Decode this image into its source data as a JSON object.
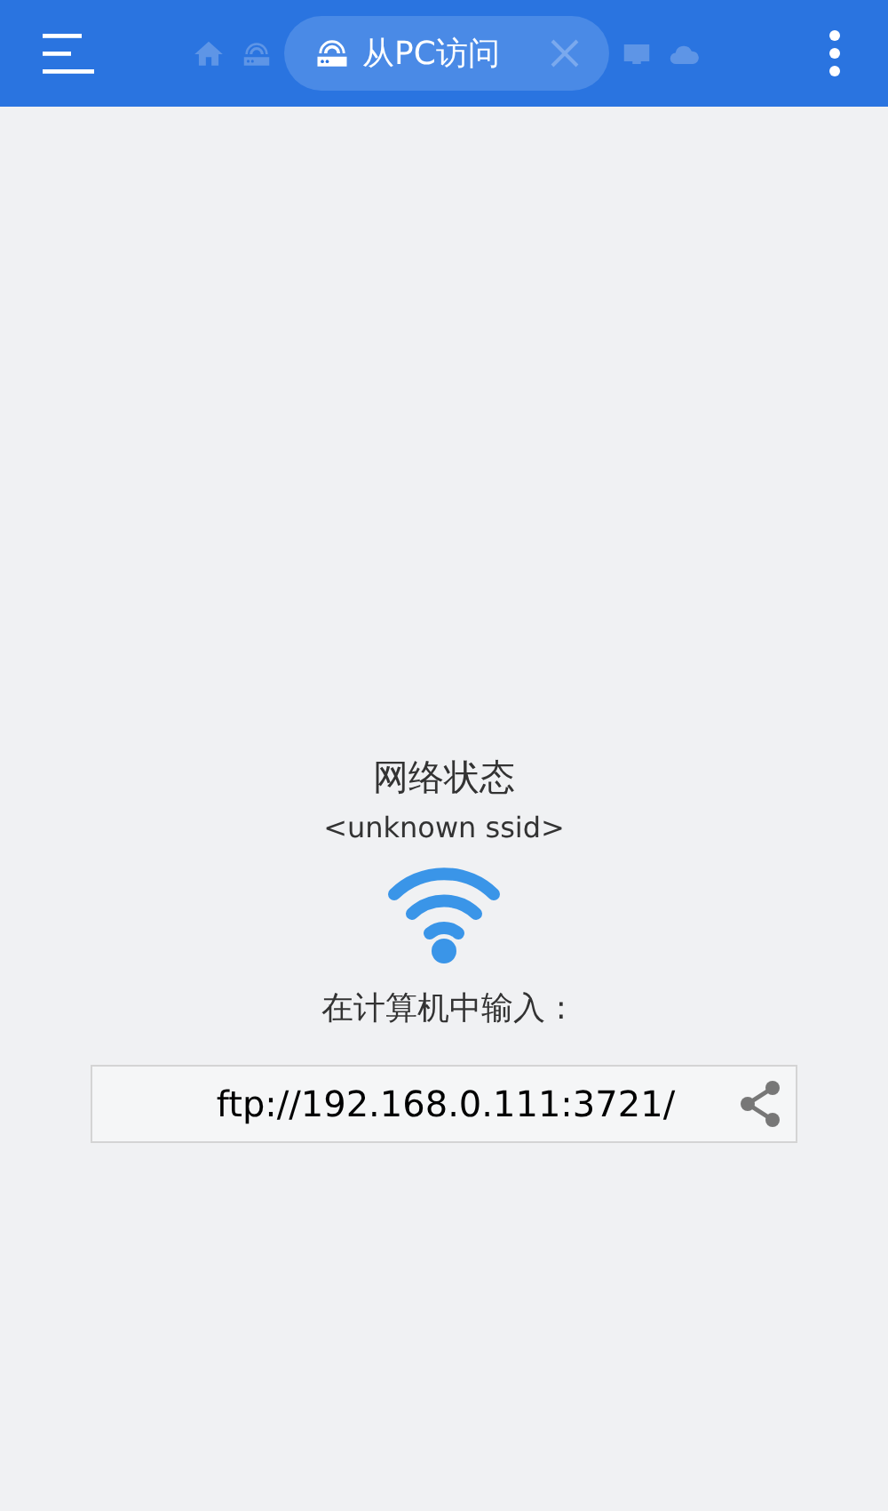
{
  "tabs": [
    {
      "kind": "home",
      "selected": false
    },
    {
      "kind": "router",
      "selected": false
    },
    {
      "kind": "router",
      "label": "从PC访问",
      "selected": true
    },
    {
      "kind": "screen",
      "selected": false
    },
    {
      "kind": "cloud",
      "selected": false
    }
  ],
  "status": {
    "title": "网络状态",
    "ssid": "<unknown ssid>"
  },
  "instruction": "在计算机中输入 :",
  "address": "ftp://192.168.0.111:3721/"
}
